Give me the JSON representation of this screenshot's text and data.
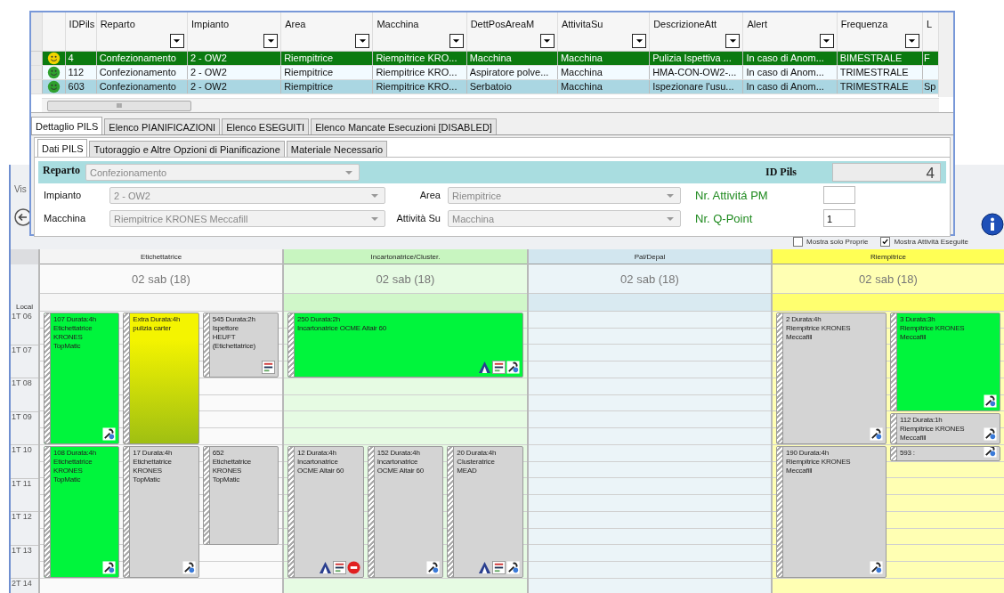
{
  "popup": {
    "grid": {
      "columns": [
        {
          "label": "IDPils",
          "filter": false
        },
        {
          "label": "Reparto",
          "filter": true
        },
        {
          "label": "Impianto",
          "filter": true
        },
        {
          "label": "Area",
          "filter": true
        },
        {
          "label": "Macchina",
          "filter": true
        },
        {
          "label": "DettPosAreaM",
          "filter": true
        },
        {
          "label": "AttivitaSu",
          "filter": true
        },
        {
          "label": "DescrizioneAtt",
          "filter": true
        },
        {
          "label": "Alert",
          "filter": true
        },
        {
          "label": "Frequenza",
          "filter": true
        },
        {
          "label": "L",
          "filter": false
        }
      ],
      "rows": [
        {
          "selected": true,
          "color": "#f2d400",
          "cells": [
            "4",
            "Confezionamento",
            "2 - OW2",
            "Riempitrice",
            "Riempitrice KRO...",
            "Macchina",
            "Macchina",
            "Pulizia Ispettiva ...",
            "In caso di Anom...",
            "BIMESTRALE",
            "F"
          ]
        },
        {
          "selected": false,
          "color": "#2ea02e",
          "cells": [
            "112",
            "Confezionamento",
            "2 - OW2",
            "Riempitrice",
            "Riempitrice KRO...",
            "Aspiratore polve...",
            "Macchina",
            "HMA-CON-OW2-...",
            "In caso di Anom...",
            "TRIMESTRALE",
            null
          ]
        },
        {
          "selected": false,
          "color": "#2ea02e",
          "cells": [
            "603",
            "Confezionamento",
            "2 - OW2",
            "Riempitrice",
            "Riempitrice KRO...",
            "Serbatoio",
            "Macchina",
            "Ispezionare l'usu...",
            "In caso di Anom...",
            "TRIMESTRALE",
            "Sp"
          ]
        }
      ],
      "scroll_label": "III"
    },
    "tabs": [
      {
        "label": "Dettaglio PILS",
        "selected": true
      },
      {
        "label": "Elenco PIANIFICAZIONI",
        "selected": false
      },
      {
        "label": "Elenco ESEGUITI",
        "selected": false
      },
      {
        "label": "Elenco Mancate Esecuzioni [DISABLED]",
        "selected": false
      }
    ],
    "subtabs": [
      {
        "label": "Dati PILS",
        "selected": true
      },
      {
        "label": "Tutoraggio e Altre Opzioni di Pianificazione",
        "selected": false
      },
      {
        "label": "Materiale Necessario",
        "selected": false
      }
    ],
    "form": {
      "reparto": {
        "label": "Reparto",
        "value": "Confezionamento",
        "disabled": true
      },
      "id_pils": {
        "label": "ID Pils",
        "value": "4"
      },
      "rows": [
        {
          "left": {
            "label": "Impianto",
            "value": "2 - OW2",
            "disabled": true
          },
          "right": {
            "label": "Area",
            "value": "Riempitrice",
            "disabled": true
          },
          "counter": {
            "label": "Nr. Attivitá PM"
          }
        },
        {
          "left": {
            "label": "Macchina",
            "value": "Riempitrice KRONES Meccafill",
            "disabled": true
          },
          "right": {
            "label": "Attività Su",
            "value": "Macchina",
            "disabled": true
          },
          "counter": {
            "label": "Nr. Q-Point",
            "value": "1"
          }
        }
      ]
    }
  },
  "calendar": {
    "view_label": "Vis",
    "show_own": {
      "label": "Mostra solo Proprie",
      "checked": false
    },
    "show_done": {
      "label": "Mostra Attività Eseguite",
      "checked": true
    },
    "time_zone": "Local",
    "hours": [
      "1T 06",
      "1T 07",
      "1T 08",
      "1T 09",
      "1T 10",
      "1T 11",
      "1T 12",
      "1T 13",
      "2T 14"
    ],
    "columns": [
      {
        "name": "Etichettatrice",
        "color": "#f4f4f4",
        "date": "02 sab (18)",
        "lanes": [
          [
            {
              "title": "107 Durata:4h",
              "text": "Etichettatrice KRONES TopMatic",
              "color": "#00f53c",
              "icons": [
                {
                  "kind": "tools"
                }
              ]
            },
            {
              "title": "108 Durata:4h",
              "text": "Etichettatrice KRONES TopMatic",
              "color": "#00f53c",
              "icons": [
                {
                  "kind": "tools"
                }
              ]
            }
          ],
          [
            {
              "title": "Extra Durata:4h",
              "text": "pulizia carter",
              "color": "#f4f400"
            },
            {
              "title": "17 Durata:4h",
              "text": "Etichettatrice KRONES TopMatic",
              "color": "#d4d4d4",
              "icons": [
                {
                  "kind": "tools"
                }
              ]
            }
          ],
          [
            {
              "title": "545 Durata:2h",
              "text": "Ispettore HEUFT (Etichettatrice)",
              "color": "#d4d4d4",
              "icons": [
                {
                  "kind": "badge"
                }
              ]
            },
            {
              "title": "652",
              "text": "Etichettatrice KRONES TopMatic",
              "color": "#d4d4d4"
            }
          ]
        ]
      },
      {
        "name": "Incartonatrice/Cluster.",
        "color": "#c8f5c0",
        "date": "02 sab (18)",
        "lanes": [
          [
            {
              "title": "250 Durata:2h",
              "text": "Incartonatrice OCME Altair 60",
              "color": "#00f53c",
              "wide": true,
              "icons": [
                {
                  "kind": "triangle"
                },
                {
                  "kind": "badge"
                },
                {
                  "kind": "tools"
                }
              ]
            },
            {
              "title": "12 Durata:4h",
              "text": "Incartonatrice OCME Altair 60",
              "color": "#d4d4d4",
              "icons": [
                {
                  "kind": "triangle"
                },
                {
                  "kind": "badge"
                },
                {
                  "kind": "disc"
                }
              ]
            }
          ],
          [
            {
              "title": "152 Durata:4h",
              "text": "Incartonatrice OCME Altair 60",
              "color": "#d4d4d4",
              "icons": [
                {
                  "kind": "tools"
                }
              ]
            }
          ],
          [
            {
              "title": "20 Durata:4h",
              "text": "Clusteratrice MEAD",
              "color": "#d4d4d4",
              "icons": [
                {
                  "kind": "triangle"
                },
                {
                  "kind": "badge"
                },
                {
                  "kind": "tools"
                }
              ]
            }
          ]
        ]
      },
      {
        "name": "Pal/Depal",
        "color": "#d2e6ef",
        "date": "02 sab (18)"
      },
      {
        "name": "Riempitrice",
        "color": "#ffff55",
        "date": "02 sab (18)",
        "lanes": [
          [
            {
              "title": "2 Durata:4h",
              "text": "Riempitrice KRONES Meccafill",
              "color": "#d4d4d4",
              "icons": [
                {
                  "kind": "tools"
                }
              ]
            },
            {
              "title": "190 Durata:4h",
              "text": "Riempitrice KRONES Meccafill",
              "color": "#d4d4d4",
              "icons": [
                {
                  "kind": "tools"
                }
              ]
            }
          ],
          [
            {
              "title": "3 Durata:3h",
              "text": "Riempitrice KRONES Meccafill",
              "color": "#00f53c",
              "icons": [
                {
                  "kind": "tools"
                }
              ]
            },
            {
              "title": "112 Durata:1h",
              "text": "Riempitrice KRONES Meccafill",
              "color": "#d4d4d4",
              "icons": [
                {
                  "kind": "tools"
                }
              ]
            },
            {
              "title": "593 :",
              "color": "#d4d4d4",
              "icons": [
                {
                  "kind": "tools"
                }
              ]
            }
          ]
        ]
      }
    ]
  }
}
